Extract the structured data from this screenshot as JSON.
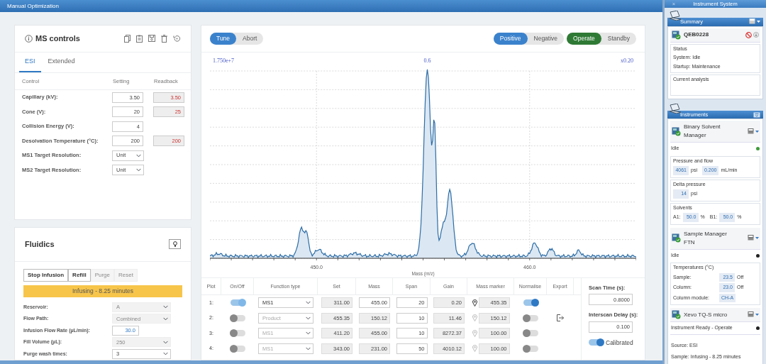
{
  "window": {
    "title": "Manual Optimization"
  },
  "ms_controls": {
    "title": "MS controls",
    "tabs": [
      {
        "label": "ESI",
        "selected": true
      },
      {
        "label": "Extended",
        "selected": false
      }
    ],
    "columns": [
      "Control",
      "Setting",
      "Readback"
    ],
    "rows": [
      {
        "label": "Capillary (kV):",
        "kind": "number",
        "setting": "3.50",
        "readback": "3.50"
      },
      {
        "label": "Cone (V):",
        "kind": "number",
        "setting": "20",
        "readback": "25"
      },
      {
        "label": "Collision Energy (V):",
        "kind": "number",
        "setting": "4"
      },
      {
        "label": "Desolvation Temperature (°C):",
        "kind": "number",
        "setting": "200",
        "readback": "200"
      },
      {
        "label": "MS1 Target Resolution:",
        "kind": "select",
        "setting": "Unit"
      },
      {
        "label": "MS2 Target Resolution:",
        "kind": "select",
        "setting": "Unit"
      }
    ]
  },
  "fluidics": {
    "title": "Fluidics",
    "buttons": [
      {
        "label": "Stop Infusion",
        "disabled": false
      },
      {
        "label": "Refill",
        "disabled": false
      },
      {
        "label": "Purge",
        "disabled": true
      },
      {
        "label": "Reset",
        "disabled": true
      }
    ],
    "status": "Infusing - 8.25 minutes",
    "fields": [
      {
        "label": "Reservoir:",
        "kind": "select",
        "value": "A",
        "disabled": true
      },
      {
        "label": "Flow Path:",
        "kind": "select",
        "value": "Combined",
        "disabled": true
      },
      {
        "label": "Infusion Flow Rate (µL/min):",
        "kind": "input",
        "value": "30.0",
        "disabled": false
      },
      {
        "label": "Fill Volume (µL):",
        "kind": "select",
        "value": "250",
        "disabled": true
      },
      {
        "label": "Purge wash times:",
        "kind": "select",
        "value": "3",
        "disabled": false
      }
    ]
  },
  "tune": {
    "mode_buttons": [
      {
        "label": "Tune",
        "selected": true
      },
      {
        "label": "Abort",
        "selected": false
      }
    ],
    "polarity": [
      {
        "label": "Positive",
        "selected": true
      },
      {
        "label": "Negative",
        "selected": false
      }
    ],
    "operate": [
      {
        "label": "Operate",
        "selected": true
      },
      {
        "label": "Standby",
        "selected": false
      }
    ],
    "spectrum": {
      "intensity": "1.750e+7",
      "peak_label": "0.6",
      "scale": "x0.20",
      "x_labels": [
        "450.0",
        "460.0"
      ],
      "x_title": "Mass (m/z)"
    },
    "functions": {
      "columns": [
        "Plot",
        "On/Off",
        "Function type",
        "Set",
        "Mass",
        "Span",
        "Gain",
        "Mass marker",
        "Normalise",
        "Export"
      ],
      "rows": [
        {
          "plot": "1:",
          "on": true,
          "function_type": "MS1",
          "set": "311.00",
          "mass": "455.00",
          "span": "20",
          "gain": "0.20",
          "marker": "455.35",
          "normalise": true,
          "export": false
        },
        {
          "plot": "2:",
          "on": false,
          "function_type": "Product",
          "set": "455.35",
          "mass": "150.12",
          "span": "10",
          "gain": "11.46",
          "marker": "150.12",
          "normalise": false,
          "export": true
        },
        {
          "plot": "3:",
          "on": false,
          "function_type": "MS1",
          "set": "411.20",
          "mass": "455.00",
          "span": "10",
          "gain": "8272.37",
          "marker": "100.00",
          "normalise": false,
          "export": false
        },
        {
          "plot": "4:",
          "on": false,
          "function_type": "MS1",
          "set": "343.00",
          "mass": "231.00",
          "span": "50",
          "gain": "4010.12",
          "marker": "100.00",
          "normalise": false,
          "export": false
        }
      ]
    },
    "scan_time": {
      "label": "Scan Time (s):",
      "value": "0.8000"
    },
    "interscan_delay": {
      "label": "Interscan Delay (s):",
      "value": "0.100"
    },
    "calibrated": {
      "label": "Calibrated",
      "on": true
    }
  },
  "instrument_system": {
    "title": "Instrument System",
    "close": "×",
    "summary": {
      "title": "Summary",
      "instrument": "QEB0228",
      "status_title": "Status",
      "status_lines": [
        "System: Idle",
        "Startup: Maintenance"
      ],
      "current_analysis": "Current analysis"
    },
    "instruments_title": "Instruments",
    "modules": [
      {
        "name": "Binary Solvent Manager",
        "state": "Idle",
        "color": "#3f9b3a",
        "groups": [
          {
            "title": "Pressure and flow",
            "rows": [
              {
                "items": [
                  {
                    "value": "4061",
                    "unit": "psi"
                  },
                  {
                    "value": "0.200",
                    "unit": "mL/min"
                  }
                ]
              }
            ]
          },
          {
            "title": "Delta pressure",
            "rows": [
              {
                "items": [
                  {
                    "value": "14",
                    "unit": "psi"
                  }
                ]
              }
            ]
          },
          {
            "title": "Solvents",
            "rows": [
              {
                "items": [
                  {
                    "label": "A1:",
                    "value": "50.0",
                    "unit": "%"
                  },
                  {
                    "label": "B1:",
                    "value": "50.0",
                    "unit": "%"
                  }
                ]
              }
            ]
          }
        ]
      },
      {
        "name": "Sample Manager FTN",
        "state": "Idle",
        "color": "#222222",
        "groups": [
          {
            "title": "Temperatures (°C)",
            "rows": [
              {
                "items": [
                  {
                    "label": "Sample:",
                    "value": "23.5",
                    "unit": "Off"
                  }
                ]
              },
              {
                "items": [
                  {
                    "label": "Column:",
                    "value": "23.0",
                    "unit": "Off"
                  }
                ]
              },
              {
                "items": [
                  {
                    "label": "Column module:",
                    "value": "CH-A"
                  }
                ]
              }
            ]
          }
        ]
      },
      {
        "name": "Xevo TQ-S micro",
        "state": "Instrument Ready - Operate",
        "color": "#222222",
        "lines": [
          "Source: ESI",
          "Sample: Infusing - 8.25 minutes"
        ]
      }
    ]
  }
}
